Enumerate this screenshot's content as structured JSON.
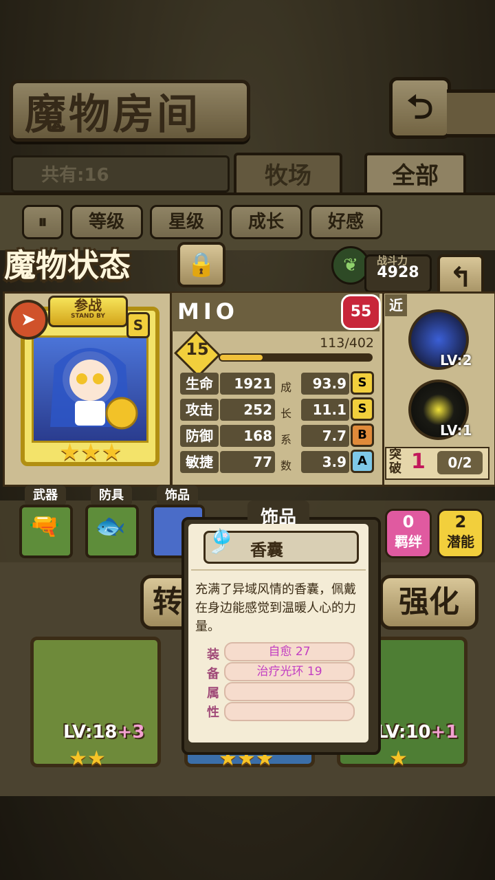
{
  "header": {
    "title": "魔物房间",
    "back_icon": "return-arrow-icon"
  },
  "counter": {
    "label": "共有:16"
  },
  "tabs": [
    {
      "label": "牧场"
    },
    {
      "label": "全部",
      "active": true
    }
  ],
  "sort": {
    "toggle_icon": "sort-toggle-icon",
    "buttons": [
      "等级",
      "星级",
      "成长",
      "好感"
    ]
  },
  "status": {
    "title": "魔物状态",
    "lock_icon": "lock-icon",
    "leaf_icon": "leaf-icon",
    "power_label": "战斗力",
    "power_value": "4928"
  },
  "monster": {
    "name": "MIO",
    "affection": "55",
    "standby": "参战",
    "standby_en": "STAND BY",
    "rank": "S",
    "stars": "★★★",
    "level": "15",
    "exp_text": "113/402",
    "exp_fraction": 0.281
  },
  "stats": [
    {
      "label": "生命",
      "value": "1921",
      "growth": "93.9",
      "grade": "S"
    },
    {
      "label": "攻击",
      "value": "252",
      "growth": "11.1",
      "grade": "S"
    },
    {
      "label": "防御",
      "value": "168",
      "growth": "7.7",
      "grade": "B"
    },
    {
      "label": "敏捷",
      "value": "77",
      "growth": "3.9",
      "grade": "A"
    }
  ],
  "growth_chars": [
    "成",
    "长",
    "系",
    "数"
  ],
  "skills": {
    "range": "近",
    "items": [
      {
        "lv": "LV:2"
      },
      {
        "lv": "LV:1"
      }
    ]
  },
  "breakthrough": {
    "label": "突破",
    "num": "1",
    "count": "0/2"
  },
  "equipment": {
    "weapon": "武器",
    "armor": "防具",
    "accessory": "饰品"
  },
  "pills": {
    "bond": {
      "num": "0",
      "label": "羁绊"
    },
    "potential": {
      "num": "2",
      "label": "潜能"
    }
  },
  "actions": {
    "left": "转",
    "enhance": "强化"
  },
  "lower_cards": [
    {
      "lv": "LV:18",
      "bonus": "+3",
      "stars": "★★"
    },
    {
      "stars": "★★★"
    },
    {
      "lv": "LV:10",
      "bonus": "+1",
      "stars": "★"
    }
  ],
  "tooltip": {
    "header": "饰品",
    "name": "香囊",
    "description": "充满了异域风情的香囊，佩戴在身边能感觉到温暖人心的力量。",
    "attr_label_chars": [
      "装",
      "备",
      "属",
      "性"
    ],
    "attrs": [
      "自愈 27",
      "治疗光环 19",
      "",
      ""
    ]
  },
  "colors": {
    "gold": "#f2cf3c",
    "grade_s": "#f2cf3c",
    "grade_b": "#e08a3a",
    "grade_a": "#7ec8e8",
    "affection": "#c8263a"
  }
}
